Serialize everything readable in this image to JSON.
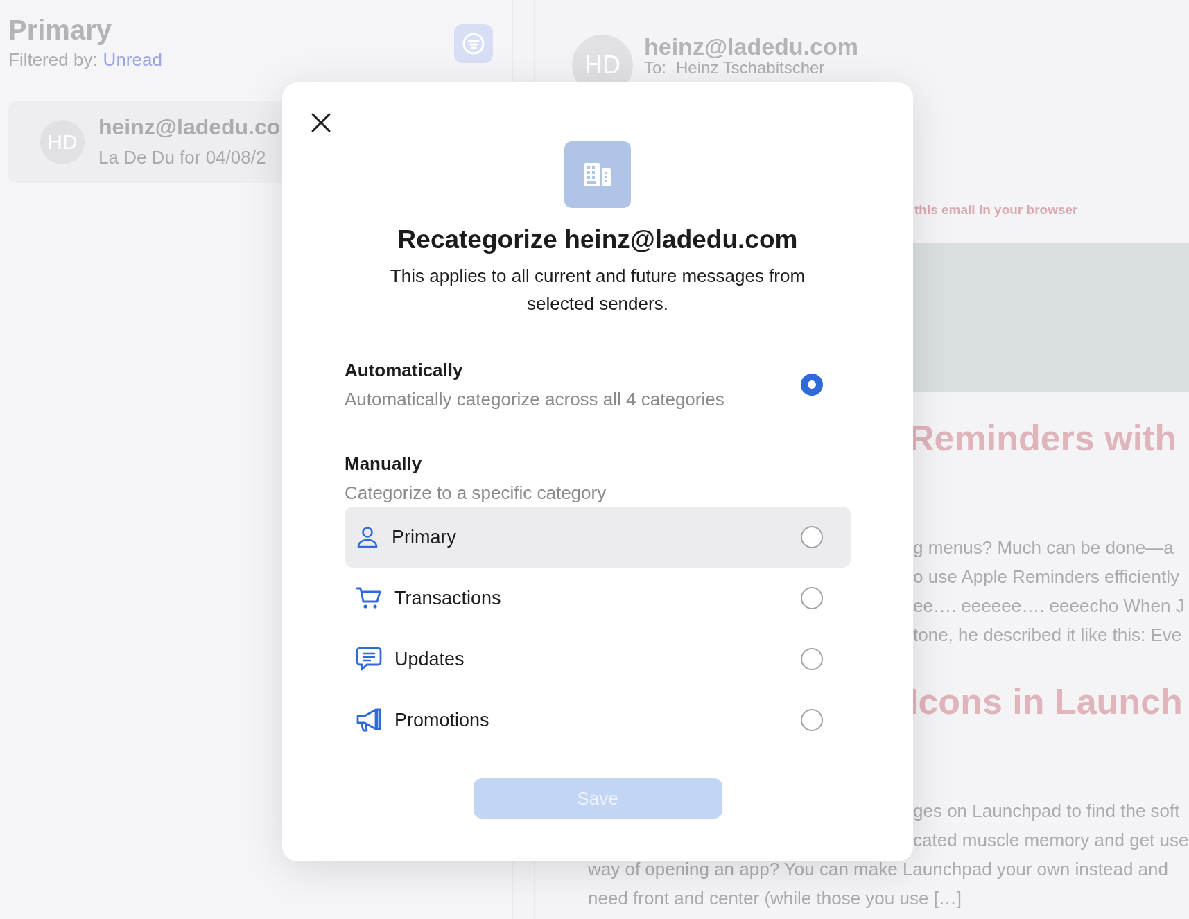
{
  "background": {
    "list_pane": {
      "title": "Primary",
      "filter_label": "Filtered by:",
      "filter_value": "Unread",
      "messages": [
        {
          "avatar": "HD",
          "sender": "heinz@ladedu.co",
          "subject": "La De Du for 04/08/2"
        }
      ]
    },
    "reading_pane": {
      "avatar": "HD",
      "sender": "heinz@ladedu.com",
      "to_label": "To:",
      "to": "Heinz Tschabitscher",
      "browser_link": "this email in your browser",
      "article": [
        {
          "kind": "heading",
          "text": "Reminders with"
        },
        {
          "kind": "line",
          "text": "g menus? Much can be done—a"
        },
        {
          "kind": "line",
          "text": "o use Apple Reminders efficiently"
        },
        {
          "kind": "line",
          "text": "ee…. eeeeee…. eeeecho When J"
        },
        {
          "kind": "line",
          "text": "tone, he described it like this: Eve"
        },
        {
          "kind": "heading",
          "text": "Icons in Launch"
        },
        {
          "kind": "line",
          "text": "ges on Launchpad to find the soft"
        },
        {
          "kind": "line",
          "text": "cated muscle memory and get use"
        }
      ],
      "article_end": [
        "way of opening an app? You can make Launchpad your own instead and",
        "need front and center (while those you use […]"
      ]
    }
  },
  "dialog": {
    "title": "Recategorize heinz@ladedu.com",
    "description": "This applies to all current and future messages from selected senders.",
    "automatic": {
      "label": "Automatically",
      "description": "Automatically categorize across all 4 categories",
      "selected": true
    },
    "manual": {
      "label": "Manually",
      "description": "Categorize to a specific category",
      "categories": [
        {
          "kind": "person",
          "label": "Primary",
          "selected": false,
          "hovered": true
        },
        {
          "kind": "cart",
          "label": "Transactions",
          "selected": false,
          "hovered": false
        },
        {
          "kind": "chat",
          "label": "Updates",
          "selected": false,
          "hovered": false
        },
        {
          "kind": "megaphone",
          "label": "Promotions",
          "selected": false,
          "hovered": false
        }
      ]
    },
    "save": {
      "label": "Save",
      "disabled": true
    }
  }
}
